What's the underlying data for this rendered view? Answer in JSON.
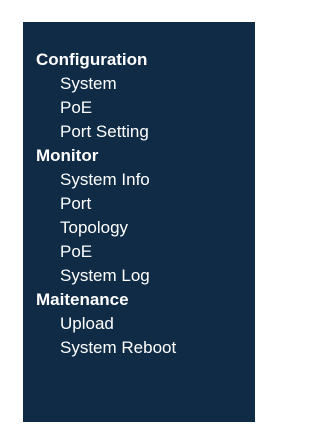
{
  "colors": {
    "panel_background": "#0f2b45",
    "text": "#ffffff"
  },
  "menu": {
    "sections": [
      {
        "title": "Configuration",
        "items": [
          "System",
          "PoE",
          "Port Setting"
        ]
      },
      {
        "title": "Monitor",
        "items": [
          "System Info",
          "Port",
          "Topology",
          "PoE",
          "System Log"
        ]
      },
      {
        "title": "Maitenance",
        "items": [
          "Upload",
          "System Reboot"
        ]
      }
    ]
  }
}
